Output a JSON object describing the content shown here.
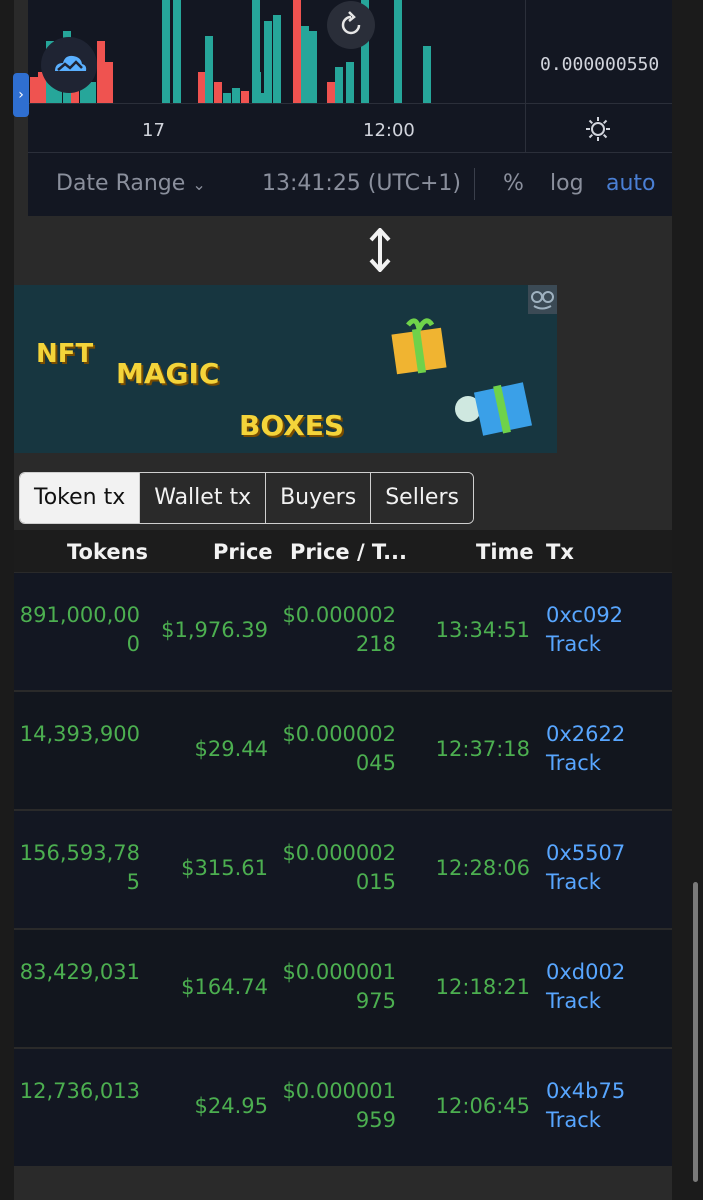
{
  "chart": {
    "price_label": "0.000000550",
    "time_ticks": [
      "17",
      "12:00"
    ],
    "toolbar": {
      "date_range": "Date Range",
      "clock": "13:41:25 (UTC+1)",
      "percent": "%",
      "log": "log",
      "auto": "auto"
    },
    "colors": {
      "up": "#26a69a",
      "down": "#ef5350",
      "bg": "#131722",
      "accent": "#2f6fd1"
    },
    "volume_bars": [
      {
        "h": 0.25,
        "c": "down"
      },
      {
        "h": 0.3,
        "c": "down"
      },
      {
        "h": 0.6,
        "c": "up"
      },
      {
        "h": 0.45,
        "c": "up"
      },
      {
        "h": 0.7,
        "c": "up"
      },
      {
        "h": 0.35,
        "c": "down"
      },
      {
        "h": 0.55,
        "c": "up"
      },
      {
        "h": 0.2,
        "c": "up"
      },
      {
        "h": 0.6,
        "c": "down"
      },
      {
        "h": 0.4,
        "c": "down"
      },
      {
        "h": 1.0,
        "c": "up"
      },
      {
        "h": 1.0,
        "c": "up"
      },
      {
        "h": 0.3,
        "c": "down"
      },
      {
        "h": 0.65,
        "c": "up"
      },
      {
        "h": 0.2,
        "c": "down"
      },
      {
        "h": 0.1,
        "c": "up"
      },
      {
        "h": 0.15,
        "c": "up"
      },
      {
        "h": 0.12,
        "c": "down"
      },
      {
        "h": 0.3,
        "c": "up"
      },
      {
        "h": 0.1,
        "c": "up"
      },
      {
        "h": 1.0,
        "c": "up"
      },
      {
        "h": 0.8,
        "c": "up"
      },
      {
        "h": 0.85,
        "c": "up"
      },
      {
        "h": 1.0,
        "c": "down"
      },
      {
        "h": 0.75,
        "c": "up"
      },
      {
        "h": 0.7,
        "c": "up"
      },
      {
        "h": 0.2,
        "c": "down"
      },
      {
        "h": 0.35,
        "c": "up"
      },
      {
        "h": 0.4,
        "c": "up"
      },
      {
        "h": 1.0,
        "c": "up"
      },
      {
        "h": 1.0,
        "c": "up"
      },
      {
        "h": 0.55,
        "c": "up"
      }
    ]
  },
  "ad": {
    "line1": "NFT",
    "line2": "MAGIC",
    "line3": "BOXES"
  },
  "tabs": [
    "Token tx",
    "Wallet tx",
    "Buyers",
    "Sellers"
  ],
  "table": {
    "headers": [
      "Tokens",
      "Price",
      "Price / T...",
      "Time",
      "Tx"
    ],
    "rows": [
      {
        "tokens": "891,000,000",
        "price": "$1,976.39",
        "ppt": "$0.000002218",
        "time": "13:34:51",
        "tx": "0xc092",
        "track": "Track"
      },
      {
        "tokens": "14,393,900",
        "price": "$29.44",
        "ppt": "$0.000002045",
        "time": "12:37:18",
        "tx": "0x2622",
        "track": "Track"
      },
      {
        "tokens": "156,593,785",
        "price": "$315.61",
        "ppt": "$0.000002015",
        "time": "12:28:06",
        "tx": "0x5507",
        "track": "Track"
      },
      {
        "tokens": "83,429,031",
        "price": "$164.74",
        "ppt": "$0.000001975",
        "time": "12:18:21",
        "tx": "0xd002",
        "track": "Track"
      },
      {
        "tokens": "12,736,013",
        "price": "$24.95",
        "ppt": "$0.000001959",
        "time": "12:06:45",
        "tx": "0x4b75",
        "track": "Track"
      }
    ]
  }
}
